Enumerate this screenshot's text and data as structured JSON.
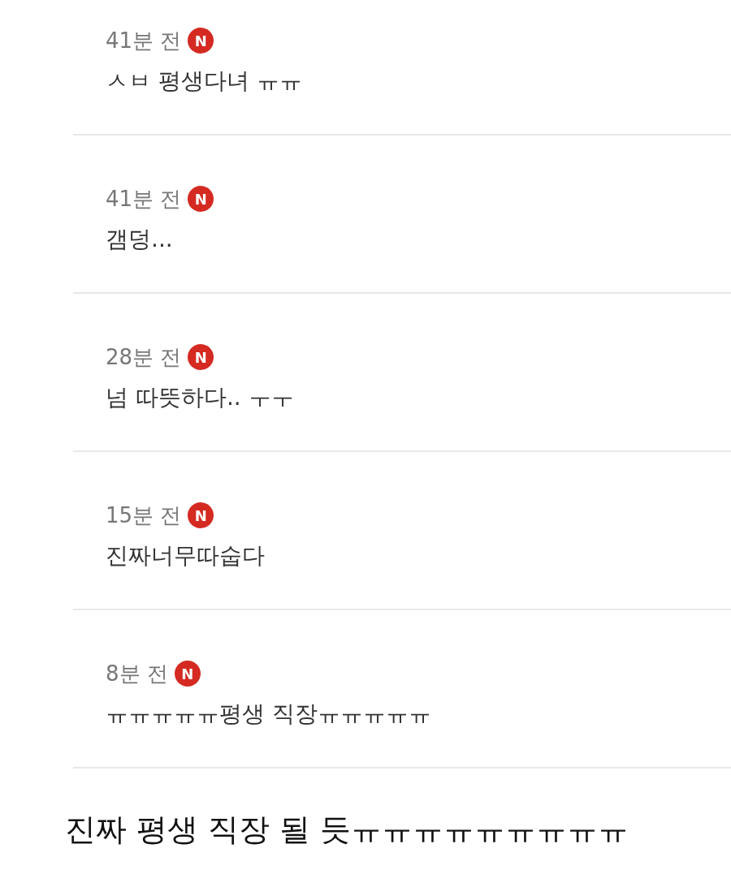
{
  "comments": [
    {
      "time": "41분 전",
      "badge": "N",
      "new": true,
      "text": "ㅅㅂ 평생다녀 ㅠㅠ"
    },
    {
      "time": "41분 전",
      "badge": "N",
      "new": true,
      "text": "갬덩..."
    },
    {
      "time": "28분 전",
      "badge": "N",
      "new": true,
      "text": "넘 따뜻하다.. ㅜㅜ"
    },
    {
      "time": "15분 전",
      "badge": "N",
      "new": true,
      "text": "진짜너무따숩다"
    },
    {
      "time": "8분 전",
      "badge": "N",
      "new": true,
      "text": "ㅠㅠㅠㅠㅠ평생 직장ㅠㅠㅠㅠㅠ"
    }
  ],
  "caption": "진짜 평생 직장 될 듯ㅠㅠㅠㅠㅠㅠㅠㅠㅠ"
}
